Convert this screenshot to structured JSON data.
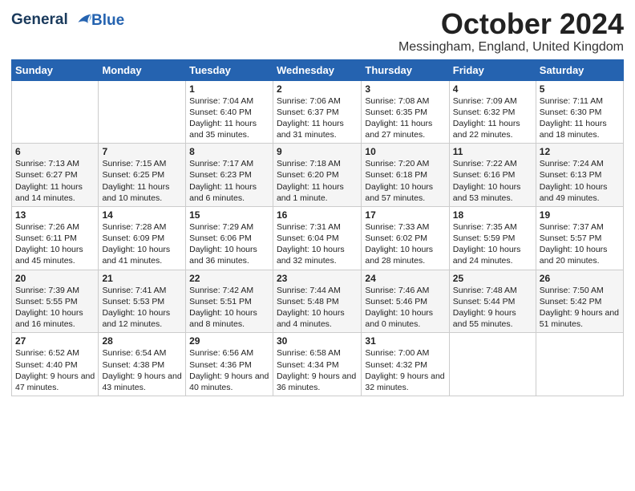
{
  "header": {
    "logo_line1": "General",
    "logo_line2": "Blue",
    "month_title": "October 2024",
    "location": "Messingham, England, United Kingdom"
  },
  "weekdays": [
    "Sunday",
    "Monday",
    "Tuesday",
    "Wednesday",
    "Thursday",
    "Friday",
    "Saturday"
  ],
  "weeks": [
    [
      {
        "day": "",
        "info": ""
      },
      {
        "day": "",
        "info": ""
      },
      {
        "day": "1",
        "info": "Sunrise: 7:04 AM\nSunset: 6:40 PM\nDaylight: 11 hours and 35 minutes."
      },
      {
        "day": "2",
        "info": "Sunrise: 7:06 AM\nSunset: 6:37 PM\nDaylight: 11 hours and 31 minutes."
      },
      {
        "day": "3",
        "info": "Sunrise: 7:08 AM\nSunset: 6:35 PM\nDaylight: 11 hours and 27 minutes."
      },
      {
        "day": "4",
        "info": "Sunrise: 7:09 AM\nSunset: 6:32 PM\nDaylight: 11 hours and 22 minutes."
      },
      {
        "day": "5",
        "info": "Sunrise: 7:11 AM\nSunset: 6:30 PM\nDaylight: 11 hours and 18 minutes."
      }
    ],
    [
      {
        "day": "6",
        "info": "Sunrise: 7:13 AM\nSunset: 6:27 PM\nDaylight: 11 hours and 14 minutes."
      },
      {
        "day": "7",
        "info": "Sunrise: 7:15 AM\nSunset: 6:25 PM\nDaylight: 11 hours and 10 minutes."
      },
      {
        "day": "8",
        "info": "Sunrise: 7:17 AM\nSunset: 6:23 PM\nDaylight: 11 hours and 6 minutes."
      },
      {
        "day": "9",
        "info": "Sunrise: 7:18 AM\nSunset: 6:20 PM\nDaylight: 11 hours and 1 minute."
      },
      {
        "day": "10",
        "info": "Sunrise: 7:20 AM\nSunset: 6:18 PM\nDaylight: 10 hours and 57 minutes."
      },
      {
        "day": "11",
        "info": "Sunrise: 7:22 AM\nSunset: 6:16 PM\nDaylight: 10 hours and 53 minutes."
      },
      {
        "day": "12",
        "info": "Sunrise: 7:24 AM\nSunset: 6:13 PM\nDaylight: 10 hours and 49 minutes."
      }
    ],
    [
      {
        "day": "13",
        "info": "Sunrise: 7:26 AM\nSunset: 6:11 PM\nDaylight: 10 hours and 45 minutes."
      },
      {
        "day": "14",
        "info": "Sunrise: 7:28 AM\nSunset: 6:09 PM\nDaylight: 10 hours and 41 minutes."
      },
      {
        "day": "15",
        "info": "Sunrise: 7:29 AM\nSunset: 6:06 PM\nDaylight: 10 hours and 36 minutes."
      },
      {
        "day": "16",
        "info": "Sunrise: 7:31 AM\nSunset: 6:04 PM\nDaylight: 10 hours and 32 minutes."
      },
      {
        "day": "17",
        "info": "Sunrise: 7:33 AM\nSunset: 6:02 PM\nDaylight: 10 hours and 28 minutes."
      },
      {
        "day": "18",
        "info": "Sunrise: 7:35 AM\nSunset: 5:59 PM\nDaylight: 10 hours and 24 minutes."
      },
      {
        "day": "19",
        "info": "Sunrise: 7:37 AM\nSunset: 5:57 PM\nDaylight: 10 hours and 20 minutes."
      }
    ],
    [
      {
        "day": "20",
        "info": "Sunrise: 7:39 AM\nSunset: 5:55 PM\nDaylight: 10 hours and 16 minutes."
      },
      {
        "day": "21",
        "info": "Sunrise: 7:41 AM\nSunset: 5:53 PM\nDaylight: 10 hours and 12 minutes."
      },
      {
        "day": "22",
        "info": "Sunrise: 7:42 AM\nSunset: 5:51 PM\nDaylight: 10 hours and 8 minutes."
      },
      {
        "day": "23",
        "info": "Sunrise: 7:44 AM\nSunset: 5:48 PM\nDaylight: 10 hours and 4 minutes."
      },
      {
        "day": "24",
        "info": "Sunrise: 7:46 AM\nSunset: 5:46 PM\nDaylight: 10 hours and 0 minutes."
      },
      {
        "day": "25",
        "info": "Sunrise: 7:48 AM\nSunset: 5:44 PM\nDaylight: 9 hours and 55 minutes."
      },
      {
        "day": "26",
        "info": "Sunrise: 7:50 AM\nSunset: 5:42 PM\nDaylight: 9 hours and 51 minutes."
      }
    ],
    [
      {
        "day": "27",
        "info": "Sunrise: 6:52 AM\nSunset: 4:40 PM\nDaylight: 9 hours and 47 minutes."
      },
      {
        "day": "28",
        "info": "Sunrise: 6:54 AM\nSunset: 4:38 PM\nDaylight: 9 hours and 43 minutes."
      },
      {
        "day": "29",
        "info": "Sunrise: 6:56 AM\nSunset: 4:36 PM\nDaylight: 9 hours and 40 minutes."
      },
      {
        "day": "30",
        "info": "Sunrise: 6:58 AM\nSunset: 4:34 PM\nDaylight: 9 hours and 36 minutes."
      },
      {
        "day": "31",
        "info": "Sunrise: 7:00 AM\nSunset: 4:32 PM\nDaylight: 9 hours and 32 minutes."
      },
      {
        "day": "",
        "info": ""
      },
      {
        "day": "",
        "info": ""
      }
    ]
  ]
}
